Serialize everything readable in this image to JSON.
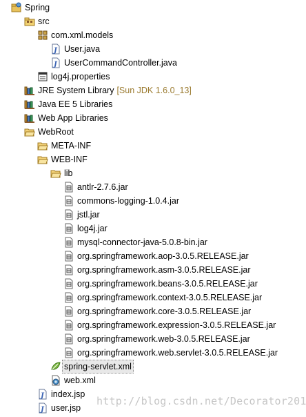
{
  "tree": [
    {
      "name": "project-spring",
      "label": "Spring",
      "icon": "project-icon",
      "depth": 0
    },
    {
      "name": "source-folder-src",
      "label": "src",
      "icon": "source-folder-icon",
      "depth": 1
    },
    {
      "name": "package-com-xml-models",
      "label": "com.xml.models",
      "icon": "package-icon",
      "depth": 2
    },
    {
      "name": "file-user-java",
      "label": "User.java",
      "icon": "java-file-icon",
      "depth": 3
    },
    {
      "name": "file-usercommandcontroller-java",
      "label": "UserCommandController.java",
      "icon": "java-file-icon",
      "depth": 3
    },
    {
      "name": "file-log4j-properties",
      "label": "log4j.properties",
      "icon": "properties-file-icon",
      "depth": 2
    },
    {
      "name": "library-jre-system",
      "label": "JRE System Library",
      "decoration": "[Sun JDK 1.6.0_13]",
      "icon": "library-icon",
      "depth": 1
    },
    {
      "name": "library-java-ee-5",
      "label": "Java EE 5 Libraries",
      "icon": "library-icon",
      "depth": 1
    },
    {
      "name": "library-web-app",
      "label": "Web App Libraries",
      "icon": "library-icon",
      "depth": 1
    },
    {
      "name": "folder-webroot",
      "label": "WebRoot",
      "icon": "folder-open-icon",
      "depth": 1
    },
    {
      "name": "folder-meta-inf",
      "label": "META-INF",
      "icon": "folder-open-icon",
      "depth": 2
    },
    {
      "name": "folder-web-inf",
      "label": "WEB-INF",
      "icon": "folder-open-icon",
      "depth": 2
    },
    {
      "name": "folder-lib",
      "label": "lib",
      "icon": "folder-open-icon",
      "depth": 3
    },
    {
      "name": "jar-antlr",
      "label": "antlr-2.7.6.jar",
      "icon": "jar-file-icon",
      "depth": 4
    },
    {
      "name": "jar-commons-logging",
      "label": "commons-logging-1.0.4.jar",
      "icon": "jar-file-icon",
      "depth": 4
    },
    {
      "name": "jar-jstl",
      "label": "jstl.jar",
      "icon": "jar-file-icon",
      "depth": 4
    },
    {
      "name": "jar-log4j",
      "label": "log4j.jar",
      "icon": "jar-file-icon",
      "depth": 4
    },
    {
      "name": "jar-mysql-connector",
      "label": "mysql-connector-java-5.0.8-bin.jar",
      "icon": "jar-file-icon",
      "depth": 4
    },
    {
      "name": "jar-spring-aop",
      "label": "org.springframework.aop-3.0.5.RELEASE.jar",
      "icon": "jar-file-icon",
      "depth": 4
    },
    {
      "name": "jar-spring-asm",
      "label": "org.springframework.asm-3.0.5.RELEASE.jar",
      "icon": "jar-file-icon",
      "depth": 4
    },
    {
      "name": "jar-spring-beans",
      "label": "org.springframework.beans-3.0.5.RELEASE.jar",
      "icon": "jar-file-icon",
      "depth": 4
    },
    {
      "name": "jar-spring-context",
      "label": "org.springframework.context-3.0.5.RELEASE.jar",
      "icon": "jar-file-icon",
      "depth": 4
    },
    {
      "name": "jar-spring-core",
      "label": "org.springframework.core-3.0.5.RELEASE.jar",
      "icon": "jar-file-icon",
      "depth": 4
    },
    {
      "name": "jar-spring-expression",
      "label": "org.springframework.expression-3.0.5.RELEASE.jar",
      "icon": "jar-file-icon",
      "depth": 4
    },
    {
      "name": "jar-spring-web",
      "label": "org.springframework.web-3.0.5.RELEASE.jar",
      "icon": "jar-file-icon",
      "depth": 4
    },
    {
      "name": "jar-spring-web-servlet",
      "label": "org.springframework.web.servlet-3.0.5.RELEASE.jar",
      "icon": "jar-file-icon",
      "depth": 4
    },
    {
      "name": "file-spring-servlet-xml",
      "label": "spring-servlet.xml",
      "icon": "spring-xml-icon",
      "depth": 3,
      "selected": true
    },
    {
      "name": "file-web-xml",
      "label": "web.xml",
      "icon": "xml-file-icon",
      "depth": 3
    },
    {
      "name": "file-index-jsp",
      "label": "index.jsp",
      "icon": "jsp-file-icon",
      "depth": 2
    },
    {
      "name": "file-user-jsp",
      "label": "user.jsp",
      "icon": "jsp-file-icon",
      "depth": 2
    }
  ],
  "watermark": "http://blog.csdn.net/Decorator2015",
  "colors": {
    "decoration": "#9b7b30",
    "folder": "#e8c25c",
    "java": "#3b64b4",
    "library": "#c08a30",
    "selection": "#e8e8e8"
  }
}
